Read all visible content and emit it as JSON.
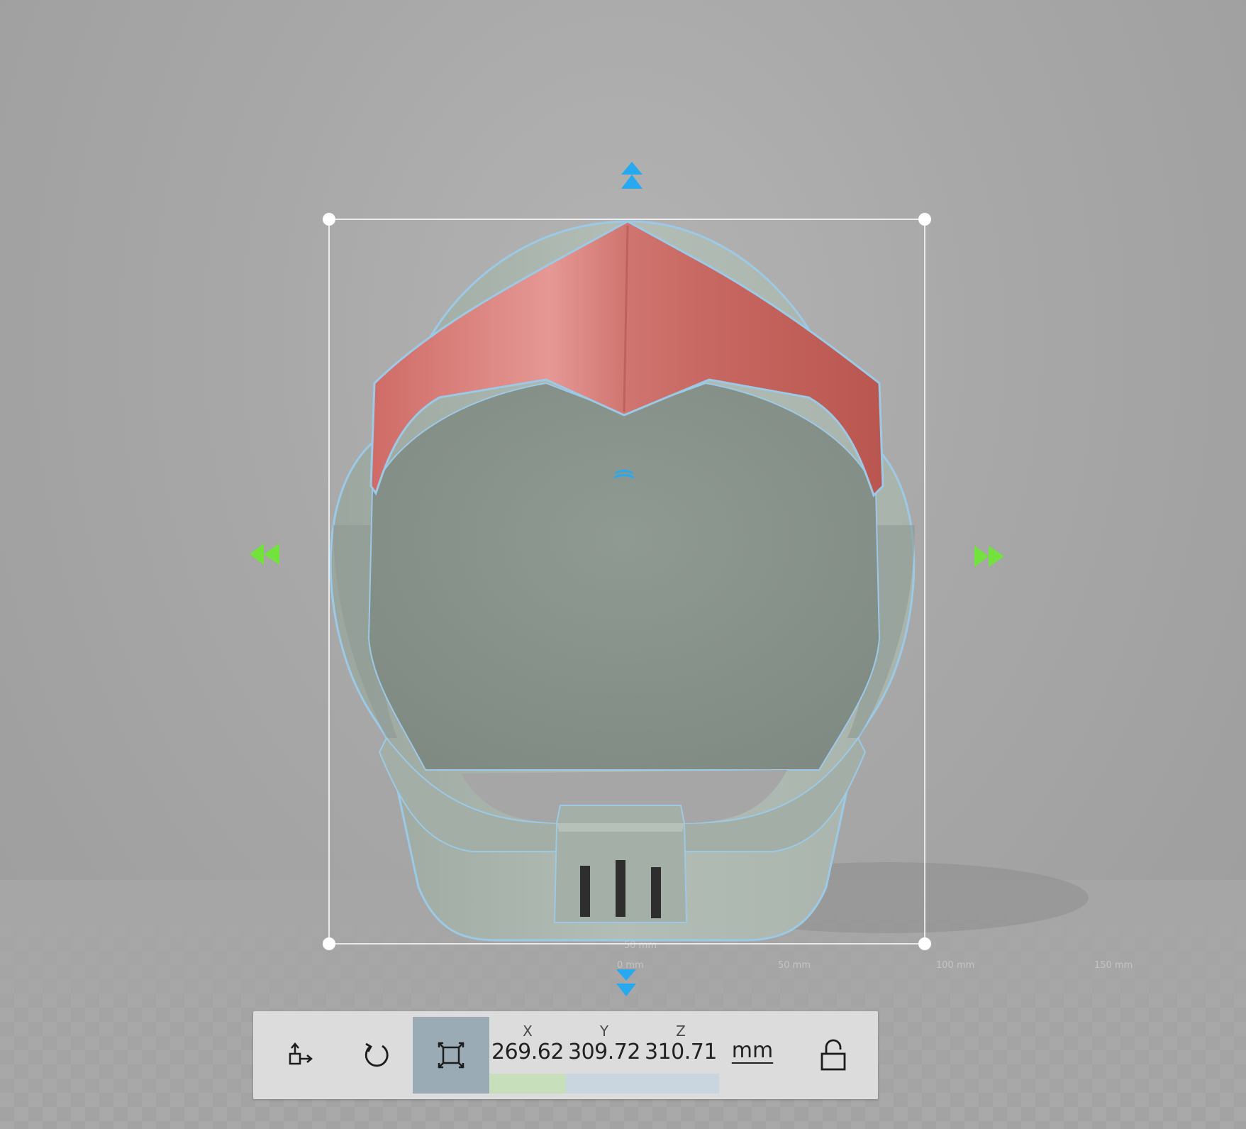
{
  "scene": {
    "model": "helmet",
    "floor_scale_labels": [
      "50 mm",
      "0 mm",
      "50 mm",
      "100 mm",
      "150 mm"
    ]
  },
  "gizmo": {
    "vertical_arrow_color": "#27a9f0",
    "horizontal_arrow_color": "#72e33c",
    "selection_box_color": "#ffffff",
    "handle_color": "#ffffff"
  },
  "toolbar": {
    "tools": [
      {
        "name": "move",
        "icon": "move-icon"
      },
      {
        "name": "rotate",
        "icon": "rotate-icon"
      },
      {
        "name": "scale",
        "icon": "scale-icon",
        "active": true
      }
    ],
    "dimensions": {
      "x_label": "X",
      "x_value": "269.62",
      "y_label": "Y",
      "y_value": "309.72",
      "z_label": "Z",
      "z_value": "310.71"
    },
    "unit": "mm",
    "lock": {
      "icon": "lock-open-icon",
      "locked": false
    },
    "colors": {
      "active_tool_bg": "#9babb6",
      "x_bar": "#c7e0bb",
      "y_bar": "#c9d6df",
      "z_bar": "#c9d6df"
    }
  }
}
